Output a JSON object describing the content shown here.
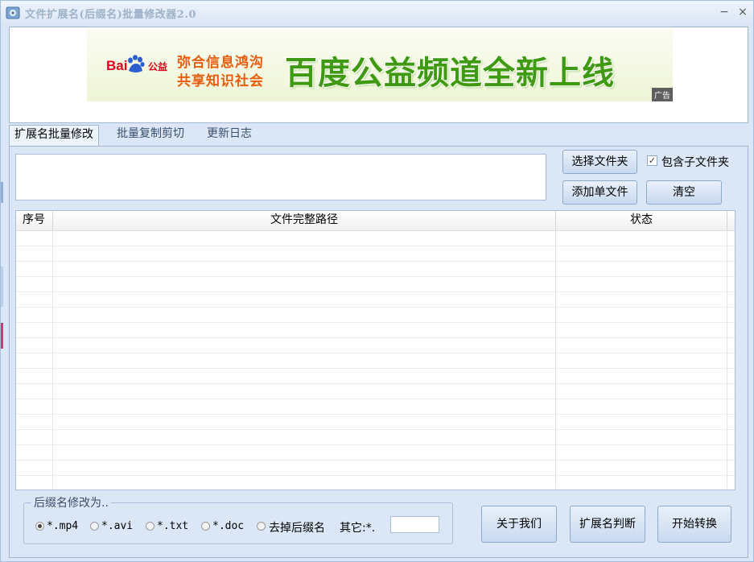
{
  "window": {
    "title": "文件扩展名(后缀名)批量修改器2.0",
    "minimize_glyph": "−",
    "close_glyph": "×"
  },
  "ad": {
    "brand": "Bai",
    "brand_gongyi": "公益",
    "slogan_line1": "弥合信息鸿沟",
    "slogan_line2": "共享知识社会",
    "headline": "百度公益频道全新上线",
    "ad_tag": "广告"
  },
  "tabs": [
    {
      "label": "扩展名批量修改",
      "active": true
    },
    {
      "label": "批量复制剪切",
      "active": false
    },
    {
      "label": "更新日志",
      "active": false
    }
  ],
  "controls": {
    "path_value": "",
    "select_folder": "选择文件夹",
    "include_subfolders": "包含子文件夹",
    "include_subfolders_checked": true,
    "add_single_file": "添加单文件",
    "clear": "清空"
  },
  "table": {
    "columns": [
      "序号",
      "文件完整路径",
      "状态"
    ],
    "rows": []
  },
  "suffix_group": {
    "legend": "后缀名修改为..",
    "options": [
      {
        "label": "*.mp4",
        "selected": true
      },
      {
        "label": "*.avi",
        "selected": false
      },
      {
        "label": "*.txt",
        "selected": false
      },
      {
        "label": "*.doc",
        "selected": false
      },
      {
        "label": "去掉后缀名",
        "selected": false
      }
    ],
    "other_label": "其它:*.",
    "other_value": ""
  },
  "actions": {
    "about": "关于我们",
    "judge": "扩展名判断",
    "start": "开始转换"
  },
  "colors": {
    "window_bg": "#dbe7f6",
    "headline_green": "#3f9a12",
    "slogan_orange": "#e85c0c",
    "baidu_red": "#e0001a"
  }
}
